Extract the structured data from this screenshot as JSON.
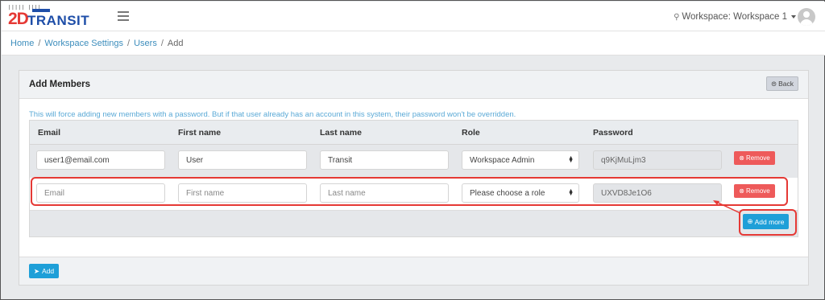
{
  "logo": {
    "two_d": "2D",
    "transit": "TRANSIT",
    "barcode": "||||| ||||"
  },
  "header": {
    "workspace_label": "Workspace: Workspace 1"
  },
  "breadcrumb": {
    "home": "Home",
    "settings": "Workspace Settings",
    "users": "Users",
    "current": "Add"
  },
  "card": {
    "title": "Add Members",
    "back_label": "Back",
    "notice": "This will force adding new members with a password. But if that user already has an account in this system, their password won't be overridden."
  },
  "table": {
    "headers": [
      "Email",
      "First name",
      "Last name",
      "Role",
      "Password"
    ],
    "rows": [
      {
        "email": "user1@email.com",
        "first": "User",
        "last": "Transit",
        "role": "Workspace Admin",
        "password": "q9KjMuLjm3",
        "remove": "Remove"
      },
      {
        "email": "Email",
        "first": "First name",
        "last": "Last name",
        "role": "Please choose a role",
        "password": "UXVD8Je1O6",
        "remove": "Remove"
      }
    ],
    "add_more": "Add more"
  },
  "footer": {
    "add_label": "Add"
  },
  "colors": {
    "accent": "#1e9fd8",
    "danger": "#ee5a5a",
    "highlight": "#e53935",
    "link": "#3c8dbc"
  }
}
